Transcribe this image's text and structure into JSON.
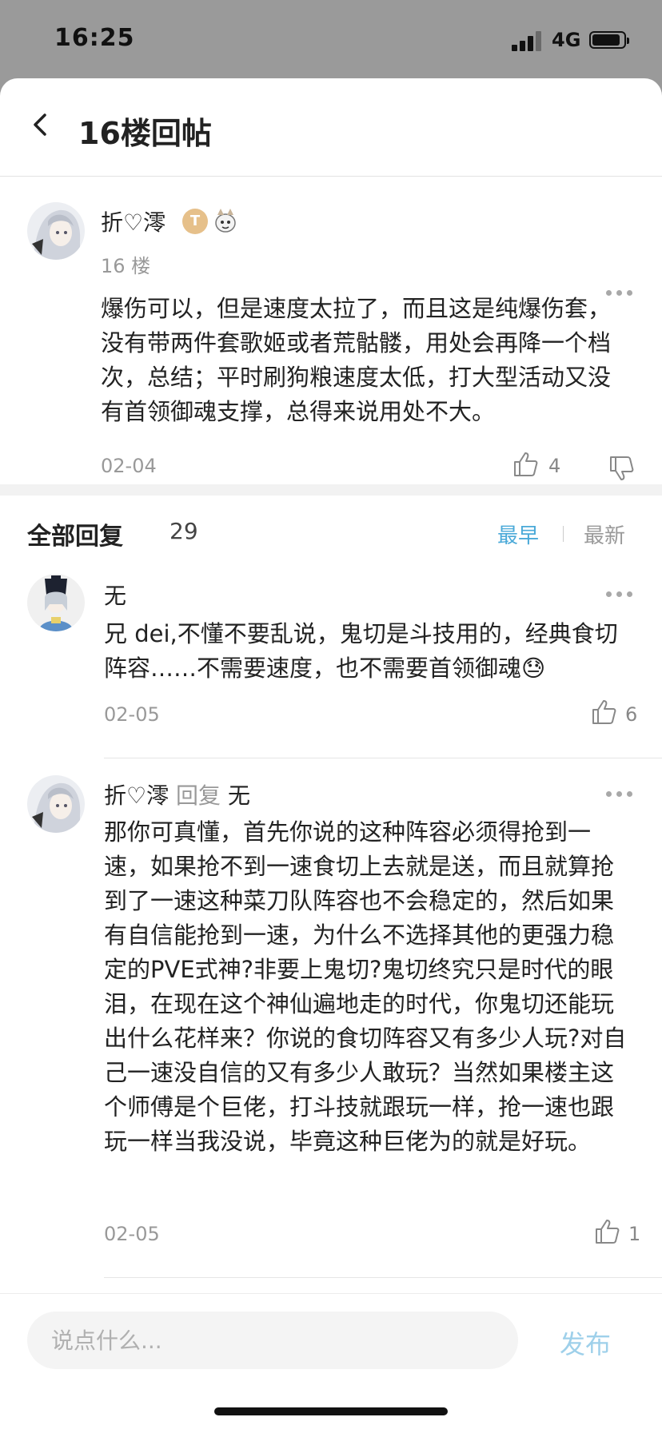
{
  "status": {
    "time": "16:25",
    "network": "4G"
  },
  "nav": {
    "title": "16楼回帖"
  },
  "post": {
    "author": "折♡澪",
    "badge_t": "T",
    "floor": "16 楼",
    "content": "爆伤可以，但是速度太拉了，而且这是纯爆伤套，没有带两件套歌姬或者荒骷髅，用处会再降一个档次，总结；平时刷狗粮速度太低，打大型活动又没有首领御魂支撑，总得来说用处不大。",
    "date": "02-04",
    "likes": "4"
  },
  "replies_header": {
    "title": "全部回复",
    "count": "29",
    "sort_early": "最早",
    "sort_new": "最新"
  },
  "replies": [
    {
      "author": "无",
      "content": "兄 dei,不懂不要乱说，鬼切是斗技用的，经典食切阵容……不需要速度，也不需要首领御魂😓",
      "date": "02-05",
      "likes": "6"
    },
    {
      "author": "折♡澪",
      "reply_word": "回复",
      "reply_to": "无",
      "content": "那你可真懂，首先你说的这种阵容必须得抢到一速，如果抢不到一速食切上去就是送，而且就算抢到了一速这种菜刀队阵容也不会稳定的，然后如果有自信能抢到一速，为什么不选择其他的更强力稳定的PVE式神?非要上鬼切?鬼切终究只是时代的眼泪，在现在这个神仙遍地走的时代，你鬼切还能玩出什么花样来？你说的食切阵容又有多少人玩?对自己一速没自信的又有多少人敢玩？当然如果楼主这个师傅是个巨佬，打斗技就跟玩一样，抢一速也跟玩一样当我没说，毕竟这种巨佬为的就是好玩。",
      "date": "02-05",
      "likes": "1"
    }
  ],
  "input": {
    "placeholder": "说点什么...",
    "publish": "发布"
  },
  "colors": {
    "accent": "#4aa9d8",
    "publish": "#9ed0ea",
    "muted": "#999999"
  }
}
